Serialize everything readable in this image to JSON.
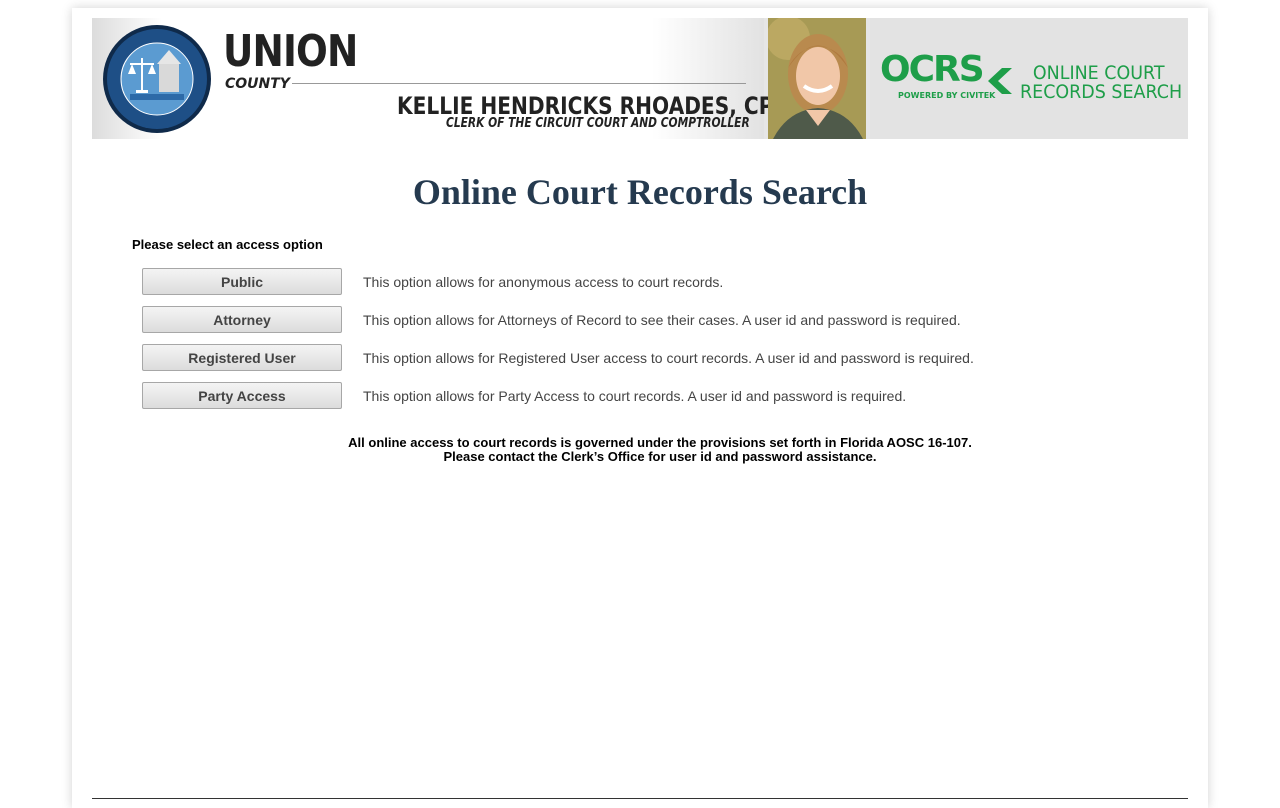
{
  "header": {
    "seal_alt": "Kellie Hendricks Rhoades, CPA - Union County Clerk of Circuit Court & Comptroller seal",
    "seal_text_top": "KELLIE HENDRICKS RHOADES, CPA",
    "seal_text_bottom": "UNION COUNTY",
    "county_name": "UNION",
    "county_word": "COUNTY",
    "clerk_name": "KELLIE HENDRICKS RHOADES, CPA",
    "clerk_title": "CLERK OF THE CIRCUIT COURT AND COMPTROLLER",
    "ocrs_logo": "OCRS",
    "ocrs_powered": "POWERED BY CIVITEK",
    "ocrs_line1": "ONLINE COURT",
    "ocrs_line2": "RECORDS SEARCH",
    "brand_color": "#1e9e49"
  },
  "page": {
    "title": "Online Court Records Search",
    "select_label": "Please select an access option"
  },
  "options": [
    {
      "label": "Public",
      "description": "This option allows for anonymous access to court records."
    },
    {
      "label": "Attorney",
      "description": "This option allows for Attorneys of Record to see their cases. A user id and password is required."
    },
    {
      "label": "Registered User",
      "description": "This option allows for Registered User access to court records. A user id and password is required."
    },
    {
      "label": "Party Access",
      "description": "This option allows for Party Access to court records. A user id and password is required."
    }
  ],
  "notice": {
    "line1": "All online access to court records is governed under the provisions set forth in Florida AOSC 16-107.",
    "line2": "Please contact the Clerk’s Office for user id and password assistance."
  }
}
